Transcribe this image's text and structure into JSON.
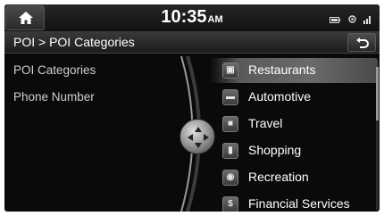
{
  "status_bar": {
    "time": "10:35",
    "ampm": "AM",
    "icons": [
      "battery-icon",
      "gps-icon",
      "signal-icon"
    ]
  },
  "title_bar": {
    "breadcrumb": "POI > POI Categories",
    "back_icon": "back-arrow-icon"
  },
  "left_menu": {
    "items": [
      {
        "label": "POI Categories"
      },
      {
        "label": "Phone Number"
      }
    ]
  },
  "poi_list": {
    "items": [
      {
        "label": "Restaurants",
        "icon": "restaurant-icon",
        "glyph": "▣",
        "selected": true
      },
      {
        "label": "Automotive",
        "icon": "car-icon",
        "glyph": "▬",
        "selected": false
      },
      {
        "label": "Travel",
        "icon": "luggage-icon",
        "glyph": "■",
        "selected": false
      },
      {
        "label": "Shopping",
        "icon": "shopping-bag-icon",
        "glyph": "▮",
        "selected": false
      },
      {
        "label": "Recreation",
        "icon": "recreation-icon",
        "glyph": "◉",
        "selected": false
      },
      {
        "label": "Financial Services",
        "icon": "dollar-icon",
        "glyph": "$",
        "selected": false
      }
    ]
  },
  "colors": {
    "background": "#0a0a0a",
    "text": "#ffffff",
    "highlight": "#6a6a6a"
  }
}
